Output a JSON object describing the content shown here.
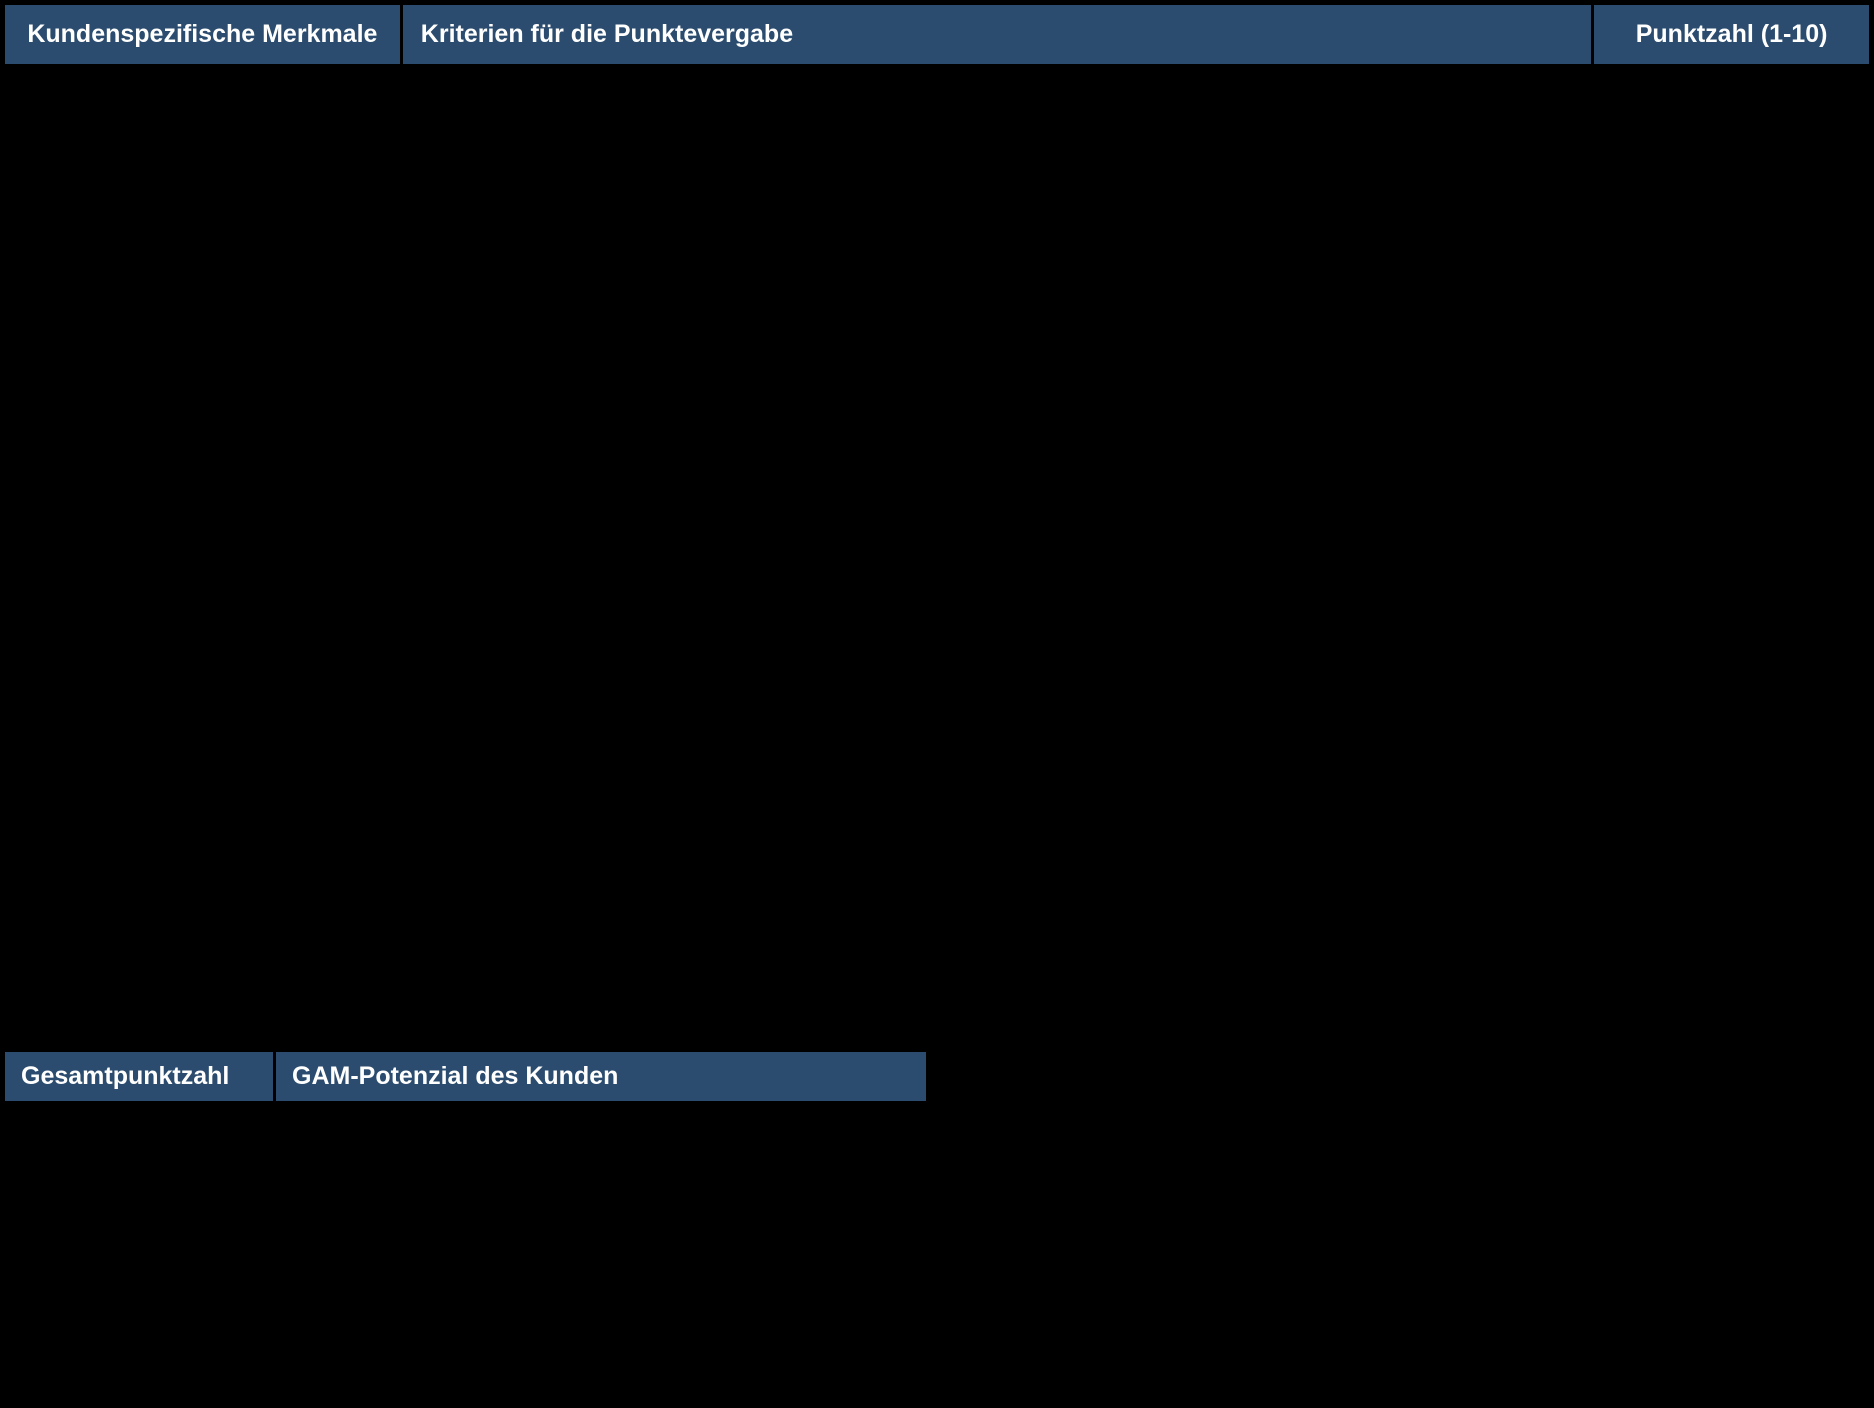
{
  "main_table": {
    "headers": {
      "merkmale": "Kundenspezifische Merkmale",
      "kriterien": "Kriterien für die Punktevergabe",
      "punktzahl": "Punktzahl (1-10)"
    }
  },
  "legend_table": {
    "headers": {
      "gesamt": "Gesamtpunktzahl",
      "potenzial": "GAM-Potenzial des Kunden"
    }
  }
}
